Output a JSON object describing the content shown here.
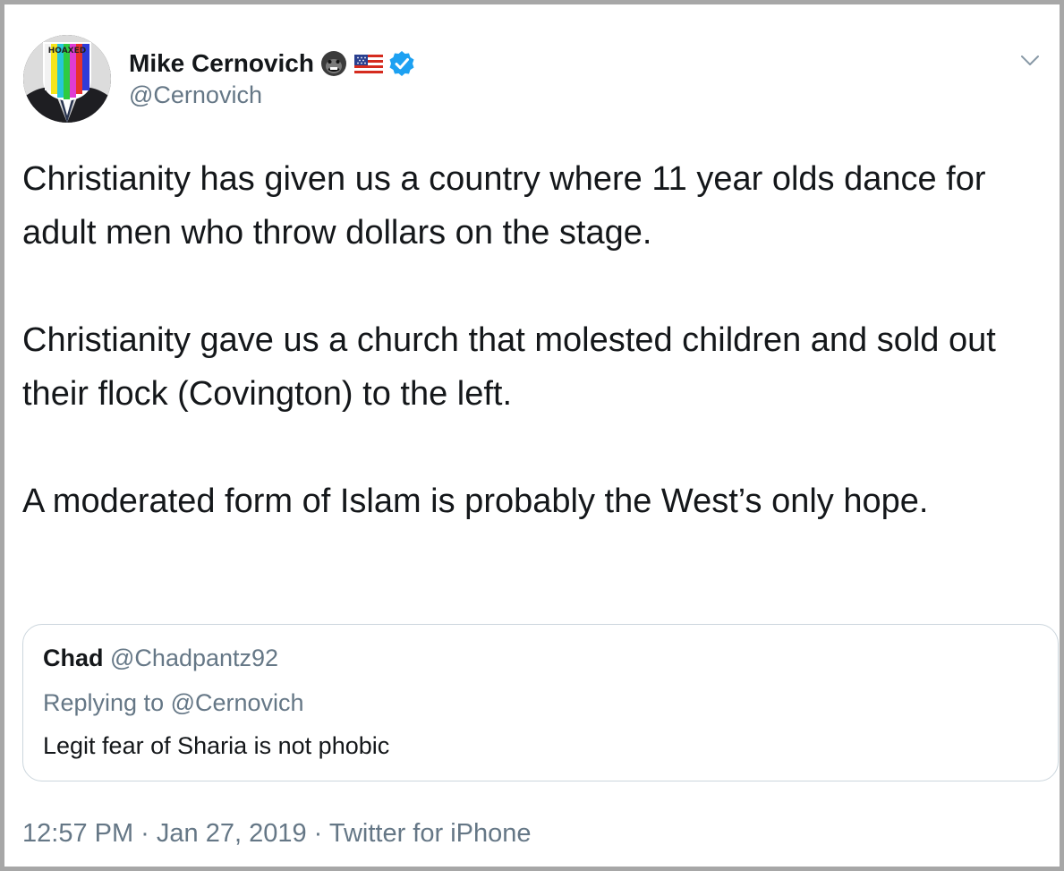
{
  "author": {
    "display_name": "Mike Cernovich",
    "handle": "@Cernovich",
    "avatar_text": "HOAXED",
    "name_badges": [
      "gorilla-emoji",
      "us-flag-emoji",
      "verified-badge"
    ]
  },
  "tweet": {
    "paragraphs": [
      "Christianity has given us a country where 11 year olds dance for adult men who throw dollars on the stage.",
      "Christianity gave us a church that molested children and sold out their flock (Covington) to the left.",
      "A moderated form of Islam is probably the West’s only hope."
    ]
  },
  "quoted_tweet": {
    "name": "Chad",
    "handle": "@Chadpantz92",
    "replying_to": "Replying to @Cernovich",
    "text": "Legit fear of Sharia is not phobic"
  },
  "meta": {
    "timestamp": "12:57 PM · Jan 27, 2019 · Twitter for iPhone"
  },
  "colors": {
    "text_primary": "#14171a",
    "text_secondary": "#657786",
    "verified_blue": "#1da1f2",
    "quote_border": "#ccd6dd",
    "frame_border": "#a7a7a7"
  }
}
